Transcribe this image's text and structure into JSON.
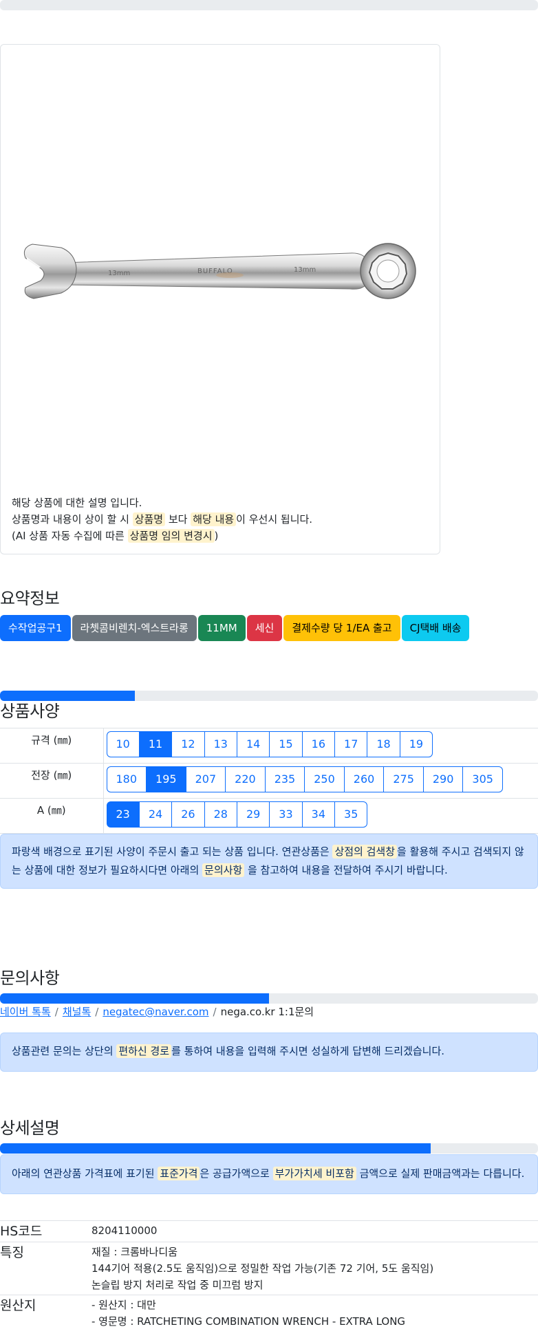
{
  "card": {
    "line1": "해당 상품에 대한 설명 입니다.",
    "line2_a": "상품명과 내용이 상이 할 시 ",
    "line2_hl1": "상품명",
    "line2_b": " 보다 ",
    "line2_hl2": "해당 내용",
    "line2_c": "이 우선시 됩니다.",
    "line3_a": "(AI 상품 자동 수집에 따른 ",
    "line3_hl": "상품명 임의 변경시",
    "line3_b": ")",
    "wrench_text": [
      "13mm",
      "BUFFALO",
      "13mm"
    ]
  },
  "summary": {
    "title": "요약정보",
    "badges": [
      "수작업공구1",
      "라쳇콤비렌치-엑스트라롱",
      "11MM",
      "세신",
      "결제수량 당 1/EA 출고",
      "CJ택배 배송"
    ]
  },
  "spec": {
    "title": "상품사양",
    "progress": 0.25,
    "rows": [
      {
        "label": "규격 (㎜)",
        "options": [
          "10",
          "11",
          "12",
          "13",
          "14",
          "15",
          "16",
          "17",
          "18",
          "19"
        ],
        "active": 1
      },
      {
        "label": "전장 (㎜)",
        "options": [
          "180",
          "195",
          "207",
          "220",
          "235",
          "250",
          "260",
          "275",
          "290",
          "305"
        ],
        "active": 1
      },
      {
        "label": "A (㎜)",
        "options": [
          "23",
          "24",
          "26",
          "28",
          "29",
          "33",
          "34",
          "35"
        ],
        "active": 0
      }
    ],
    "note_a": "파랑색 배경으로 표기된 사양이 주문시 출고 되는 상품 입니다. 연관상품은 ",
    "note_hl1": "상점의 검색창",
    "note_b": "을 활용해 주시고 검색되지 않",
    "note_c": "는 상품에 대한 정보가 필요하시다면 아래의 ",
    "note_hl2": "문의사항",
    "note_d": " 을 참고하여 내용을 전달하여 주시기 바랍니다."
  },
  "inquiry": {
    "title": "문의사항",
    "progress": 0.5,
    "links": [
      "네이버 톡톡",
      "채널톡",
      "negatec@naver.com"
    ],
    "plain": "nega.co.kr 1:1문의",
    "separator": "/",
    "note_a": "상품관련 문의는 상단의 ",
    "note_hl": "편하신 경로",
    "note_b": "를 통하여 내용을 입력해 주시면 성실하게 답변해 드리겠습니다."
  },
  "detail": {
    "title": "상세설명",
    "progress": 0.8,
    "note_a": "아래의 연관상품 가격표에 표기된 ",
    "note_hl1": "표준가격",
    "note_b": "은 공급가액으로 ",
    "note_hl2": "부가가치세 비포함",
    "note_c": " 금액으로 실제 판매금액과는 다릅니다.",
    "rows": [
      {
        "key": "HS코드",
        "lines": [
          "8204110000"
        ]
      },
      {
        "key": "특징",
        "lines": [
          "재질 : 크롬바나디움",
          "144기어 적용(2.5도 움직임)으로 정밀한 작업 가능(기존 72 기어, 5도 움직임)",
          "논슬립 방지 처리로 작업 중 미끄럼 방지"
        ]
      },
      {
        "key": "원산지",
        "lines": [
          "- 원산지 : 대만",
          "- 영문명 : RATCHETING COMBINATION WRENCH - EXTRA LONG"
        ]
      }
    ]
  }
}
